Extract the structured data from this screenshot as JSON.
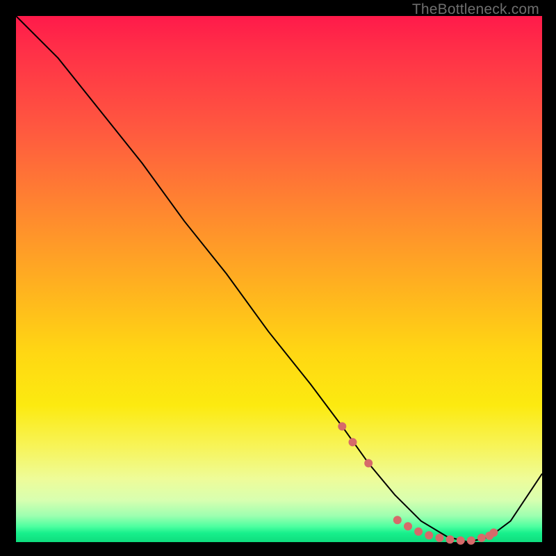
{
  "watermark": "TheBottleneck.com",
  "colors": {
    "dot": "#d66a6a",
    "line": "#000000"
  },
  "chart_data": {
    "type": "line",
    "title": "",
    "xlabel": "",
    "ylabel": "",
    "xlim": [
      0,
      100
    ],
    "ylim": [
      0,
      100
    ],
    "grid": false,
    "series": [
      {
        "name": "curve",
        "x": [
          0,
          8,
          16,
          24,
          32,
          40,
          48,
          56,
          62,
          67,
          72,
          77,
          82,
          86,
          90,
          94,
          100
        ],
        "y": [
          100,
          92,
          82,
          72,
          61,
          51,
          40,
          30,
          22,
          15,
          9,
          4,
          1,
          0,
          1,
          4,
          13
        ]
      }
    ],
    "markers": {
      "name": "valley-dots",
      "x": [
        62,
        64,
        67,
        72.5,
        74.5,
        76.5,
        78.5,
        80.5,
        82.5,
        84.5,
        86.5,
        88.5,
        90,
        90.8
      ],
      "y": [
        22,
        19,
        15,
        4.2,
        3.0,
        2.0,
        1.3,
        0.8,
        0.5,
        0.3,
        0.3,
        0.8,
        1.2,
        1.8
      ]
    }
  }
}
